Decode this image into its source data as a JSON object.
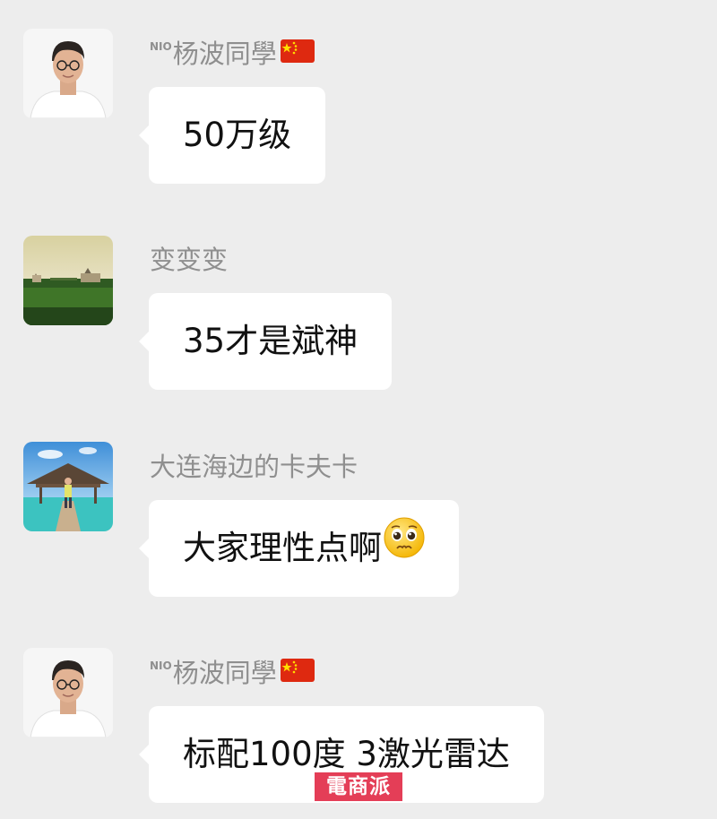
{
  "messages": [
    {
      "sender_prefix": "NIO",
      "sender": "杨波同學",
      "text": "50万级"
    },
    {
      "sender": "变变变",
      "text": "35才是斌神"
    },
    {
      "sender": "大连海边的卡夫卡",
      "text": "大家理性点啊"
    },
    {
      "sender_prefix": "NIO",
      "sender": "杨波同學",
      "text": "标配100度 3激光雷达"
    }
  ],
  "watermark": "電商派",
  "colors": {
    "background": "#ededed",
    "bubble": "#ffffff",
    "sender_name": "#8f8f8f",
    "watermark": "#e43e57"
  },
  "icons": {
    "flag": "china-flag-icon",
    "emoji": "pleading-face-emoji-icon"
  }
}
